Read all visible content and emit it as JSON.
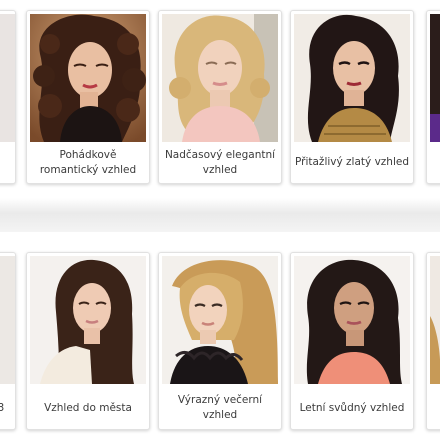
{
  "gallery_top": {
    "items": [
      {
        "label": "",
        "photo": "woman-portrait-dark-hair-cropped"
      },
      {
        "label": "Pohádkově romantický vzhled",
        "photo": "woman-dark-curly-hair"
      },
      {
        "label": "Nadčasový elegantní vzhled",
        "photo": "woman-blonde-wavy-hair"
      },
      {
        "label": "Přitažlivý zlatý vzhled",
        "photo": "woman-dark-long-hair-gold-top"
      },
      {
        "label": "",
        "photo": "woman-portrait-purple-cropped"
      }
    ]
  },
  "gallery_bottom": {
    "items": [
      {
        "label": "3",
        "photo": "woman-portrait-cropped"
      },
      {
        "label": "Vzhled do města",
        "photo": "woman-brunette-straight-hair-lace"
      },
      {
        "label": "Výrazný večerní vzhled",
        "photo": "woman-blonde-long-hair-black-ruffle"
      },
      {
        "label": "Letní svůdný vzhled",
        "photo": "woman-dark-wavy-hair-coral-top"
      },
      {
        "label": "",
        "photo": "woman-portrait-cropped"
      }
    ]
  },
  "colors": {
    "card_border": "#e1e1e1",
    "caption_text": "#3b3b3b",
    "page_background": "#f4f4f4"
  }
}
